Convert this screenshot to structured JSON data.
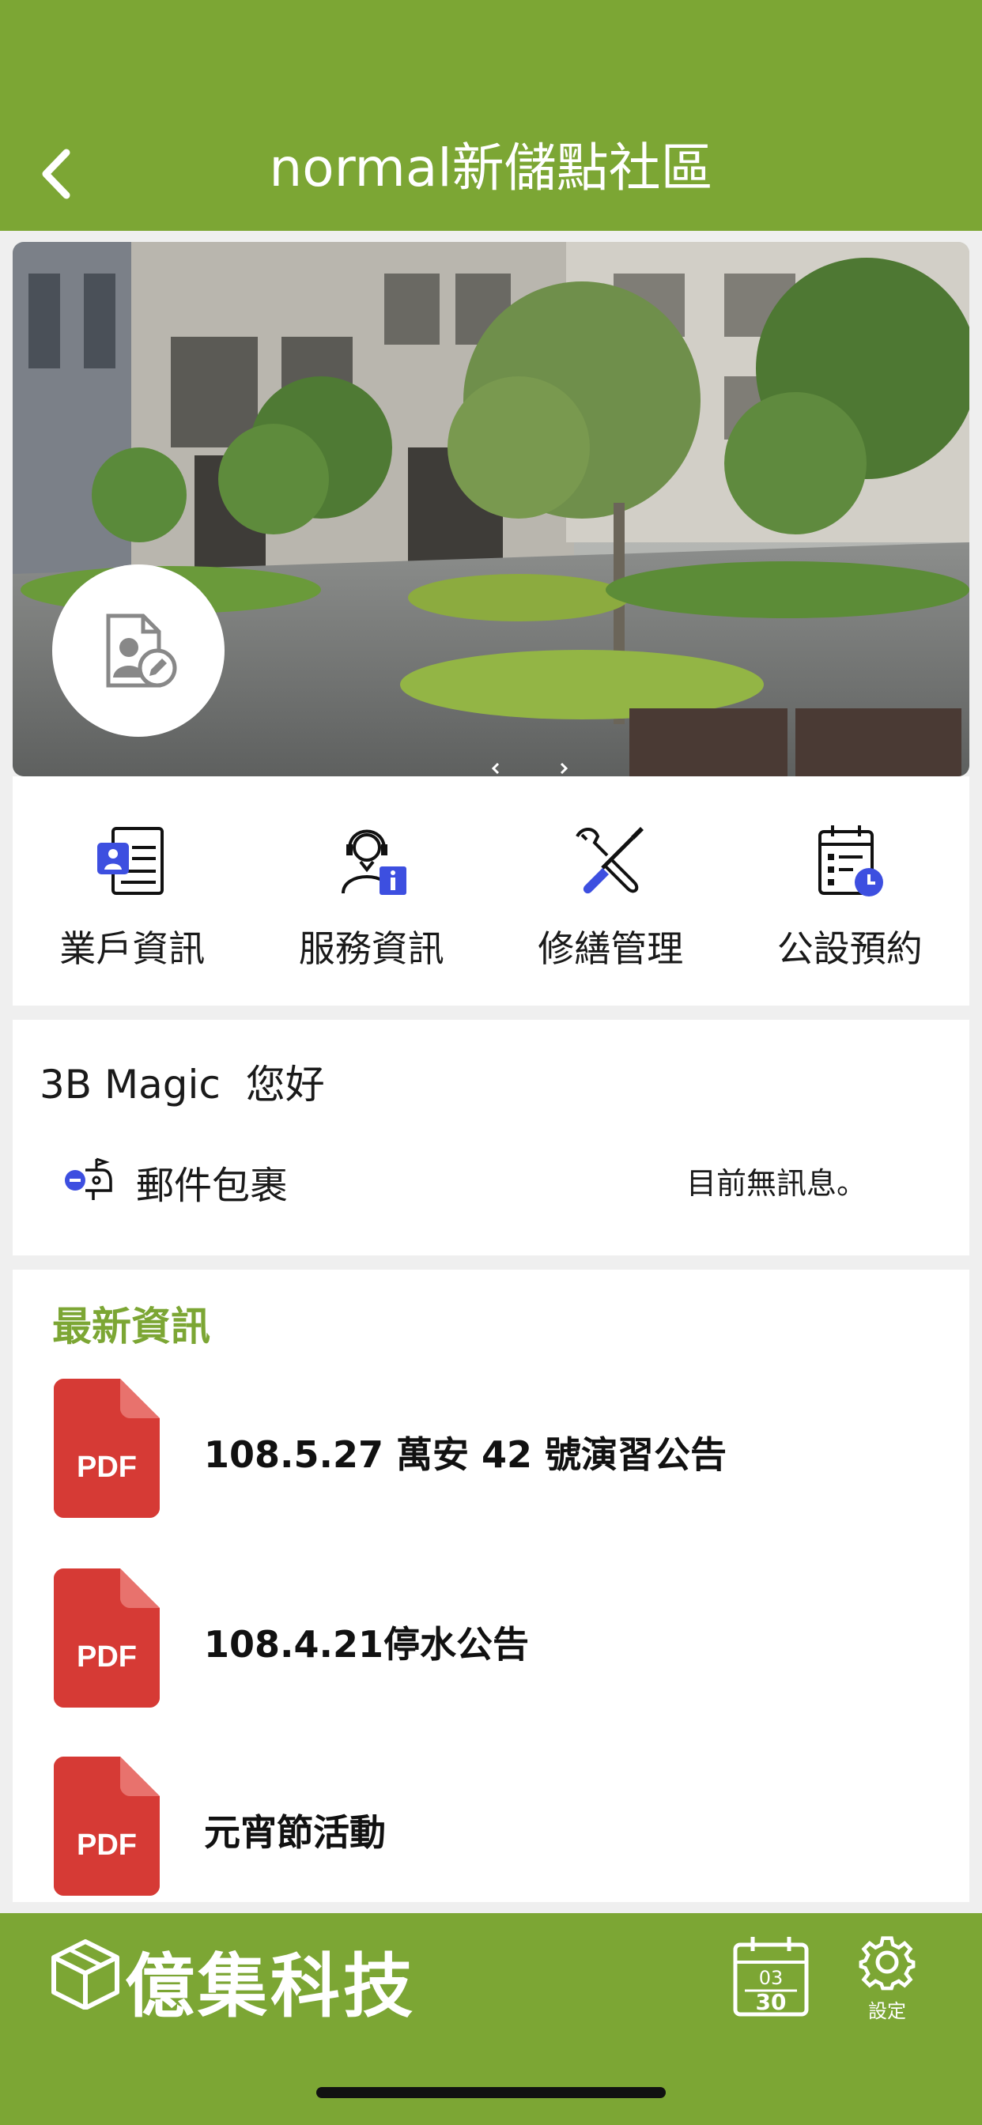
{
  "header": {
    "title": "normal新儲點社區",
    "back_icon": "chevron-left-icon"
  },
  "hero": {
    "avatar_icon": "profile-edit-icon"
  },
  "menu": {
    "items": [
      {
        "label": "業戶資訊",
        "icon": "resident-info-icon"
      },
      {
        "label": "服務資訊",
        "icon": "service-info-icon"
      },
      {
        "label": "修繕管理",
        "icon": "repair-tools-icon"
      },
      {
        "label": "公設預約",
        "icon": "facility-booking-icon"
      }
    ]
  },
  "greeting": {
    "user": "3B Magic",
    "text": "3B Magic  您好",
    "mail_label": "郵件包裹",
    "mail_status": "目前無訊息。",
    "mail_icon": "mailbox-icon"
  },
  "news": {
    "title": "最新資訊",
    "pdf_badge": "PDF",
    "items": [
      {
        "title": "108.5.27 萬安 42 號演習公告"
      },
      {
        "title": "108.4.21停水公告"
      },
      {
        "title": "元宵節活動"
      }
    ]
  },
  "footer": {
    "brand": "億集科技",
    "brand_icon": "cube-logo-icon",
    "calendar": {
      "month": "03",
      "day": "30"
    },
    "settings_label": "設定"
  },
  "colors": {
    "brand_green": "#7ca634",
    "accent_blue": "#3d4fe0",
    "pdf_red": "#d63a35"
  }
}
